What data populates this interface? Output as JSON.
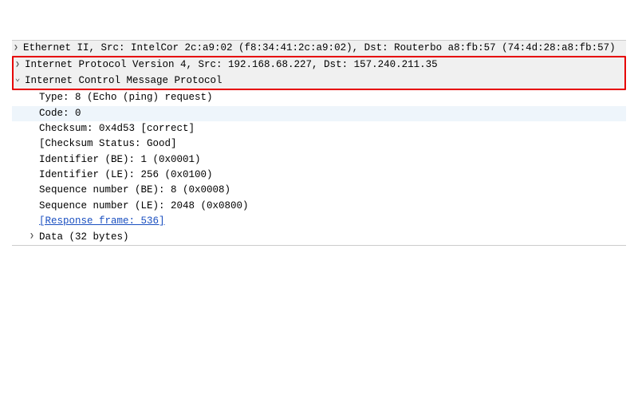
{
  "ethernet": {
    "text": "Ethernet II, Src: IntelCor 2c:a9:02 (f8:34:41:2c:a9:02), Dst: Routerbo a8:fb:57 (74:4d:28:a8:fb:57)"
  },
  "ipv4": {
    "text": "Internet Protocol Version 4, Src: 192.168.68.227, Dst: 157.240.211.35"
  },
  "icmp": {
    "header": "Internet Control Message Protocol",
    "type": "Type: 8 (Echo (ping) request)",
    "code": "Code: 0",
    "checksum": "Checksum: 0x4d53 [correct]",
    "checksum_status": "[Checksum Status: Good]",
    "ident_be": "Identifier (BE): 1 (0x0001)",
    "ident_le": "Identifier (LE): 256 (0x0100)",
    "seq_be": "Sequence number (BE): 8 (0x0008)",
    "seq_le": "Sequence number (LE): 2048 (0x0800)",
    "response_frame": "[Response frame: 536]",
    "data": "Data (32 bytes)"
  }
}
